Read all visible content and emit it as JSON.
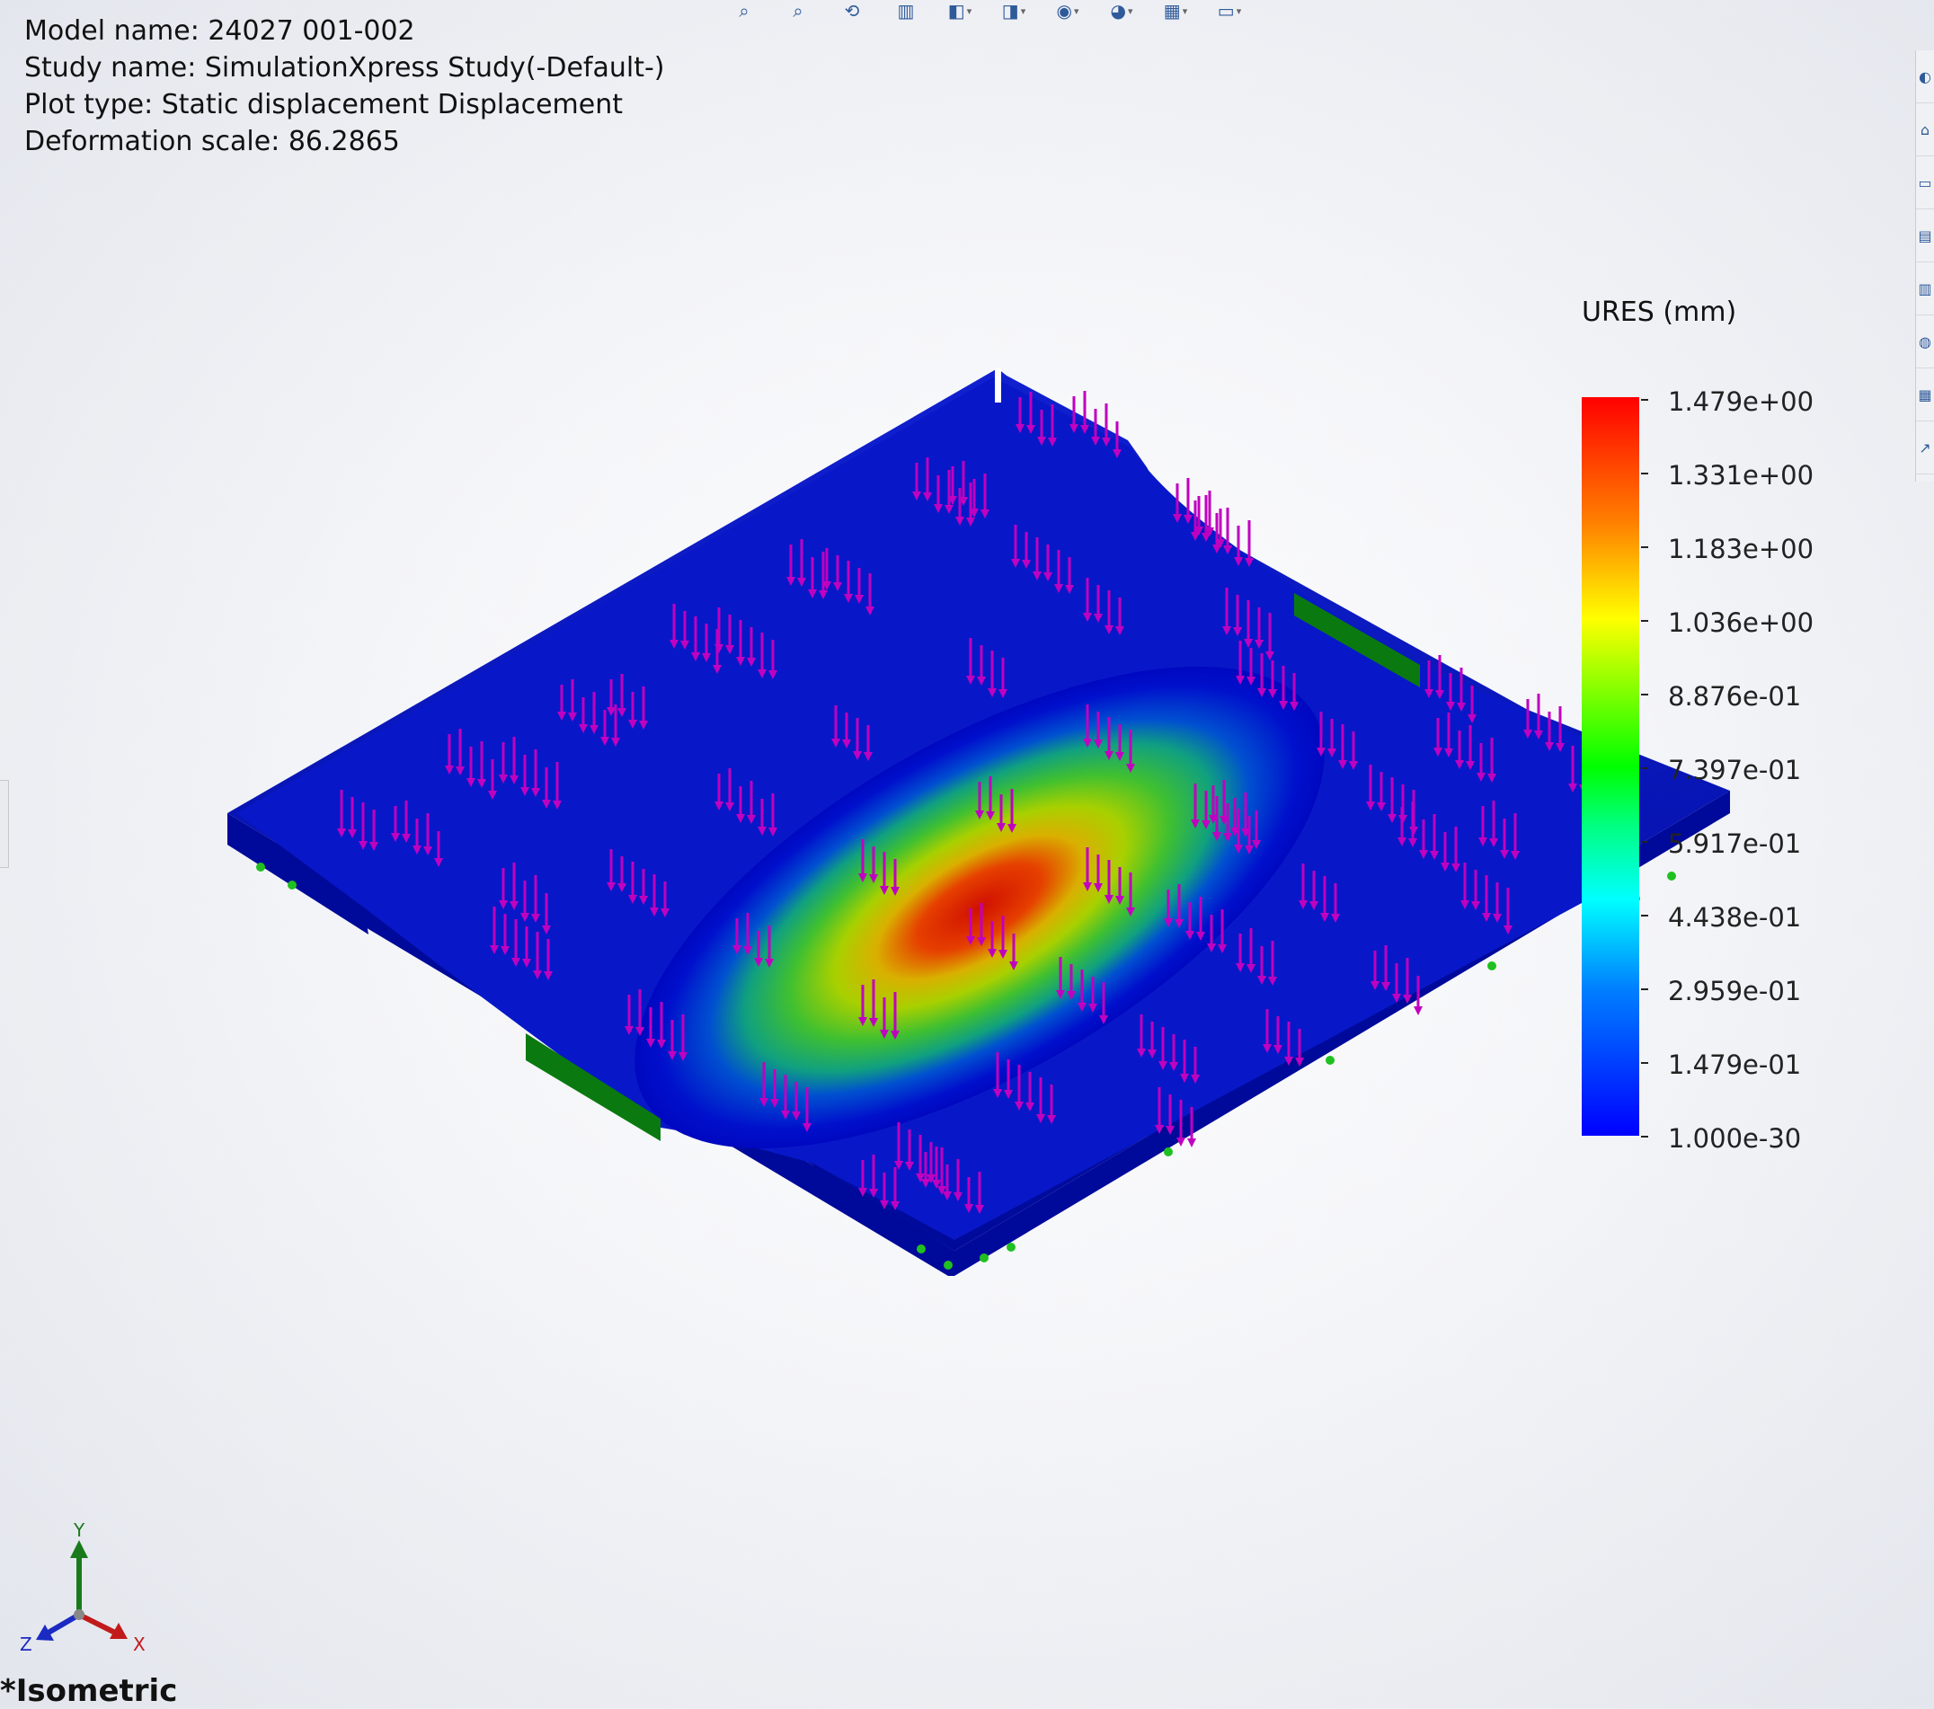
{
  "info": {
    "model_name": "Model name: 24027 001-002",
    "study_name": "Study name: SimulationXpress Study(-Default-)",
    "plot_type": "Plot type: Static displacement Displacement",
    "deformation_scale": "Deformation scale: 86.2865"
  },
  "toolbar": {
    "icons": [
      "zoom-to-fit-icon",
      "zoom-area-icon",
      "previous-view-icon",
      "section-view-icon",
      "view-orientation-icon",
      "display-style-icon",
      "hide-show-icon",
      "edit-appearance-icon",
      "apply-scene-icon",
      "view-settings-icon"
    ]
  },
  "right_panel": {
    "icons": [
      "resources-icon",
      "design-library-icon",
      "file-explorer-icon",
      "view-palette-icon",
      "appearances-icon",
      "custom-properties-icon",
      "solidworks-forum-icon",
      "simulation-results-icon"
    ]
  },
  "legend": {
    "title": "URES (mm)",
    "labels": [
      "1.479e+00",
      "1.331e+00",
      "1.183e+00",
      "1.036e+00",
      "8.876e-01",
      "7.397e-01",
      "5.917e-01",
      "4.438e-01",
      "2.959e-01",
      "1.479e-01",
      "1.000e-30"
    ],
    "colors": [
      "#ff0000",
      "#ff8000",
      "#ffff00",
      "#80ff00",
      "#00ff00",
      "#00ff80",
      "#00ffff",
      "#0080ff",
      "#0000ff"
    ]
  },
  "triad": {
    "y": "Y",
    "x": "X",
    "z": "Z"
  },
  "view_name": "*Isometric"
}
